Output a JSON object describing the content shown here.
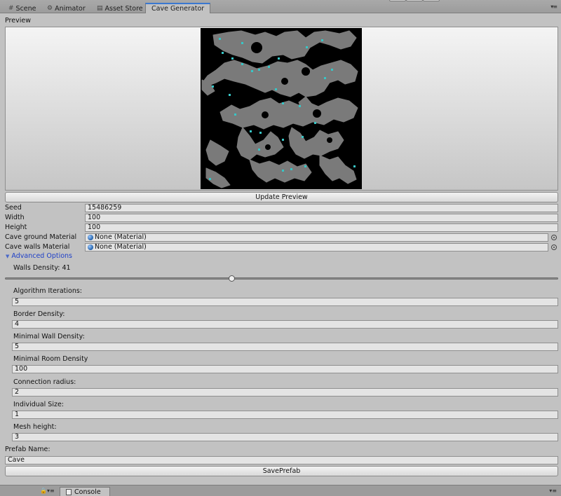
{
  "tabs": [
    {
      "label": "Scene",
      "icon": "grid-icon"
    },
    {
      "label": "Animator",
      "icon": "animator-icon"
    },
    {
      "label": "Asset Store",
      "icon": "store-icon"
    },
    {
      "label": "Cave Generator",
      "icon": ""
    }
  ],
  "icons": {
    "tab_menu": "▾≡",
    "lock": "🔒▾≡",
    "picker": "object-picker-icon"
  },
  "preview": {
    "label": "Preview"
  },
  "update_button": "Update Preview",
  "props": {
    "seed": {
      "label": "Seed",
      "value": "15486259"
    },
    "width": {
      "label": "Width",
      "value": "100"
    },
    "height": {
      "label": "Height",
      "value": "100"
    },
    "ground_material": {
      "label": "Cave ground Material",
      "value": "None (Material)"
    },
    "walls_material": {
      "label": "Cave walls Material",
      "value": "None (Material)"
    }
  },
  "advanced": {
    "label": "Advanced Options",
    "walls_density_label": "Walls Density: 41",
    "walls_density_value": 41,
    "fields": [
      {
        "label": "Algorithm Iterations:",
        "value": "5"
      },
      {
        "label": "Border Density:",
        "value": "4"
      },
      {
        "label": "Minimal Wall Density:",
        "value": "5"
      },
      {
        "label": "Minimal Room Density",
        "value": "100"
      },
      {
        "label": "Connection radius:",
        "value": "2"
      },
      {
        "label": "Individual Size:",
        "value": "1"
      },
      {
        "label": "Mesh height:",
        "value": "3"
      }
    ]
  },
  "prefab": {
    "label": "Prefab Name:",
    "value": "Cave",
    "save_button": "SavePrefab"
  },
  "bottom": {
    "console_label": "Console"
  },
  "colors": {
    "map_background": "#000000",
    "cave_floor": "#7a7a7a",
    "marker": "#38c6c6",
    "selected_tab_accent": "#3a78d0",
    "foldout_link": "#1d3fc8"
  }
}
